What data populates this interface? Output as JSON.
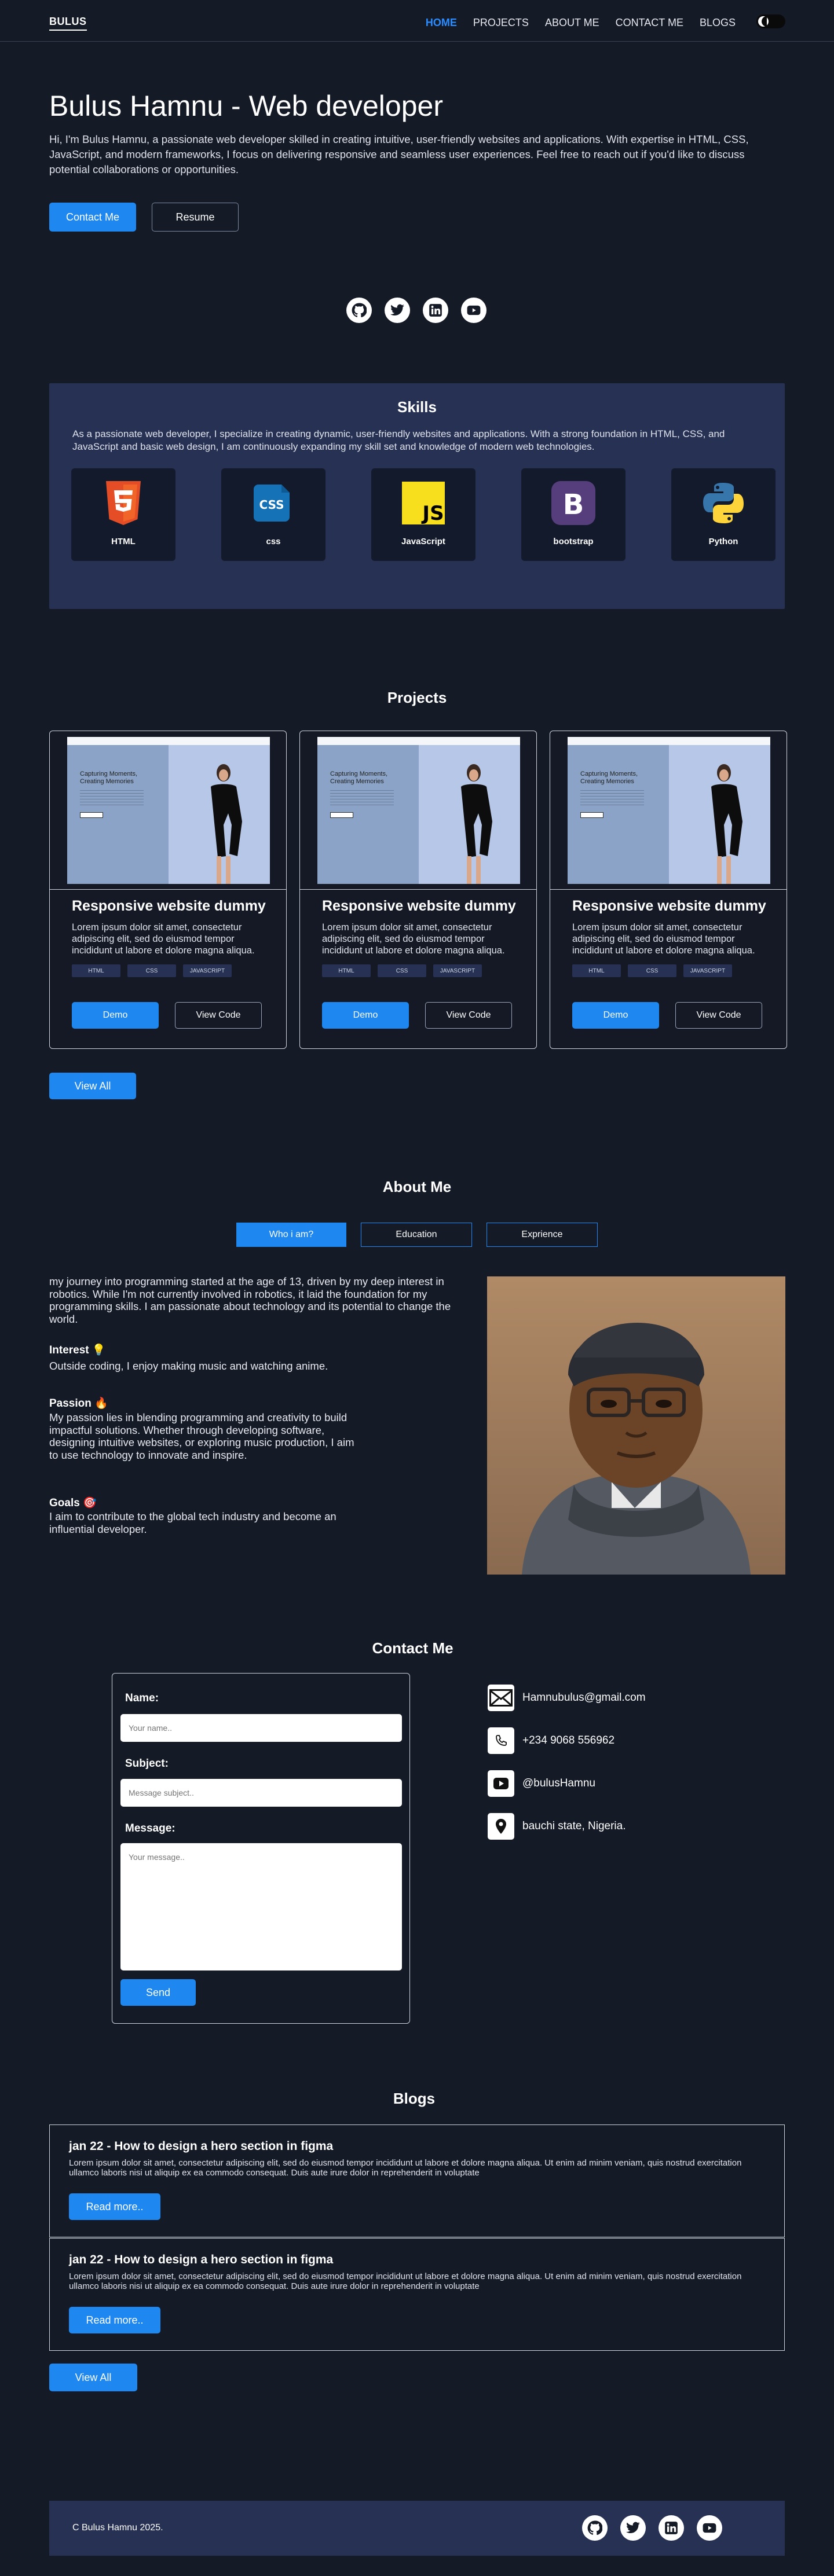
{
  "nav": {
    "logo": "BULUS",
    "links": [
      "HOME",
      "PROJECTS",
      "ABOUT ME",
      "CONTACT ME",
      "BLOGS"
    ]
  },
  "hero": {
    "title": "Bulus Hamnu - Web developer",
    "text": "Hi, I'm Bulus Hamnu, a passionate web developer skilled in creating intuitive, user-friendly websites and applications. With expertise in HTML, CSS, JavaScript, and modern frameworks, I focus on delivering responsive and seamless user experiences. Feel free to reach out if you'd like to discuss potential collaborations or opportunities.",
    "contact_btn": "Contact Me",
    "resume_btn": "Resume"
  },
  "skills": {
    "title": "Skills",
    "text": "As a passionate web developer, I specialize in creating dynamic, user-friendly websites and applications. With a strong foundation in HTML, CSS, and JavaScript and basic web design, I am continuously expanding my skill set and knowledge of modern web technologies.",
    "items": [
      "HTML",
      "css",
      "JavaScript",
      "bootstrap",
      "Python"
    ]
  },
  "projects": {
    "title": "Projects",
    "view_all": "View All",
    "items": [
      {
        "title": "Responsive website dummy",
        "desc": "Lorem ipsum dolor sit amet, consectetur adipiscing elit, sed do eiusmod tempor incididunt ut labore et dolore magna aliqua.",
        "tags": [
          "HTML",
          "CSS",
          "JAVASCRIPT"
        ],
        "demo": "Demo",
        "code": "View Code",
        "preview_heading": "Capturing Moments, Creating Memories"
      },
      {
        "title": "Responsive website dummy",
        "desc": "Lorem ipsum dolor sit amet, consectetur adipiscing elit, sed do eiusmod tempor incididunt ut labore et dolore magna aliqua.",
        "tags": [
          "HTML",
          "CSS",
          "JAVASCRIPT"
        ],
        "demo": "Demo",
        "code": "View Code",
        "preview_heading": "Capturing Moments, Creating Memories"
      },
      {
        "title": "Responsive website dummy",
        "desc": "Lorem ipsum dolor sit amet, consectetur adipiscing elit, sed do eiusmod tempor incididunt ut labore et dolore magna aliqua.",
        "tags": [
          "HTML",
          "CSS",
          "JAVASCRIPT"
        ],
        "demo": "Demo",
        "code": "View Code",
        "preview_heading": "Capturing Moments, Creating Memories"
      }
    ]
  },
  "about": {
    "title": "About Me",
    "tabs": [
      "Who i am?",
      "Education",
      "Exprience"
    ],
    "intro": "my journey into programming started at the age of 13, driven by my deep interest in robotics. While I'm not currently involved in robotics, it laid the foundation for my programming skills. I am passionate about technology and its potential to change the world.",
    "interest_h": "Interest 💡",
    "interest": "Outside coding, I enjoy making music and watching anime.",
    "passion_h": "Passion 🔥",
    "passion": "My passion lies in blending programming and creativity to build impactful solutions. Whether through developing software, designing intuitive websites, or exploring music production, I aim to use technology to innovate and inspire.",
    "goals_h": "Goals 🎯",
    "goals": "I aim to contribute to the global tech industry and become an influential developer."
  },
  "contact": {
    "title": "Contact Me",
    "name_label": "Name:",
    "name_ph": "Your name..",
    "subject_label": "Subject:",
    "subject_ph": "Message subject..",
    "message_label": "Message:",
    "message_ph": "Your message..",
    "send": "Send",
    "email": "Hamnubulus@gmail.com",
    "phone": "+234 9068 556962",
    "youtube": "@bulusHamnu",
    "location": "bauchi state, Nigeria."
  },
  "blogs": {
    "title": "Blogs",
    "view_all": "View All",
    "items": [
      {
        "title": "jan 22 - How to design a hero section in figma",
        "text": "Lorem ipsum dolor sit amet, consectetur adipiscing elit, sed do eiusmod tempor incididunt ut labore et dolore magna aliqua. Ut enim ad minim veniam, quis nostrud exercitation ullamco laboris nisi ut aliquip ex ea commodo consequat. Duis aute irure dolor in reprehenderit in voluptate",
        "btn": "Read more.."
      },
      {
        "title": "jan 22 - How to design a hero section in figma",
        "text": "Lorem ipsum dolor sit amet, consectetur adipiscing elit, sed do eiusmod tempor incididunt ut labore et dolore magna aliqua. Ut enim ad minim veniam, quis nostrud exercitation ullamco laboris nisi ut aliquip ex ea commodo consequat. Duis aute irure dolor in reprehenderit in voluptate",
        "btn": "Read more.."
      }
    ]
  },
  "footer": {
    "copyright": "C Bulus Hamnu 2025."
  },
  "icons": [
    "github-icon",
    "twitter-icon",
    "linkedin-icon",
    "youtube-icon"
  ],
  "colors": {
    "accent": "#1e88f0",
    "background": "#151a27",
    "panel": "#263153"
  }
}
